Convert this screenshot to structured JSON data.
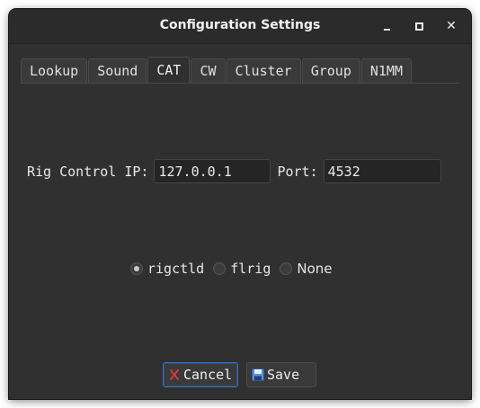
{
  "window": {
    "title": "Configuration Settings",
    "controls": {
      "minimize": "minimize-icon",
      "maximize": "maximize-icon",
      "close": "close-icon"
    }
  },
  "tabs": [
    {
      "label": "Lookup",
      "active": false
    },
    {
      "label": "Sound",
      "active": false
    },
    {
      "label": "CAT",
      "active": true
    },
    {
      "label": "CW",
      "active": false
    },
    {
      "label": "Cluster",
      "active": false
    },
    {
      "label": "Group",
      "active": false
    },
    {
      "label": "N1MM",
      "active": false
    }
  ],
  "cat": {
    "rig_ip_label": "Rig Control IP:",
    "rig_ip_value": "127.0.0.1",
    "port_label": "Port:",
    "port_value": "4532",
    "radio_options": [
      {
        "label": "rigctld",
        "checked": true
      },
      {
        "label": "flrig",
        "checked": false
      },
      {
        "label": "None",
        "checked": false
      }
    ]
  },
  "buttons": {
    "cancel_label": "Cancel",
    "cancel_icon": "cancel-x-icon",
    "save_label": "Save",
    "save_icon": "floppy-disk-icon"
  },
  "colors": {
    "window_bg": "#303030",
    "titlebar_bg": "#2b2b2b",
    "focus_border": "#3d6fb4",
    "cancel_icon": "#d23c3c",
    "save_icon": "#5b8fd6"
  }
}
